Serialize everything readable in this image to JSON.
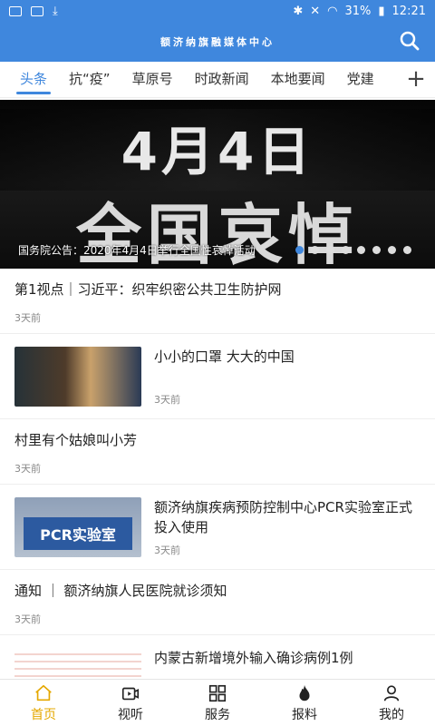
{
  "status_bar": {
    "battery": "31%",
    "time": "12:21"
  },
  "header": {
    "title": "额济纳旗融媒体中心"
  },
  "tabs": [
    {
      "label": "头条",
      "active": true
    },
    {
      "label": "抗“疫”"
    },
    {
      "label": "草原号"
    },
    {
      "label": "时政新闻"
    },
    {
      "label": "本地要闻"
    },
    {
      "label": "党建"
    }
  ],
  "banner": {
    "line1": "4月4日",
    "line2": "全国哀悼",
    "caption": "国务院公告：2020年4月4日举行全国性哀悼活动",
    "dot_count": 8,
    "active_dot": 0
  },
  "feed": [
    {
      "title": "第1视点｜习近平：织牢织密公共卫生防护网",
      "time": "3天前"
    },
    {
      "title": "小小的口罩 大大的中国",
      "time": "3天前",
      "thumb": "mask"
    },
    {
      "title": "村里有个姑娘叫小芳",
      "time": "3天前"
    },
    {
      "title": "额济纳旗疾病预防控制中心PCR实验室正式投入使用",
      "time": "3天前",
      "thumb": "pcr",
      "thumb_text": "PCR实验室"
    },
    {
      "title": "通知 ｜ 额济纳旗人民医院就诊须知",
      "time": "3天前"
    },
    {
      "title": "内蒙古新增境外输入确诊病例1例",
      "thumb": "list"
    }
  ],
  "bottom_nav": [
    {
      "label": "首页",
      "icon": "home-icon",
      "active": true
    },
    {
      "label": "视听",
      "icon": "video-icon"
    },
    {
      "label": "服务",
      "icon": "grid-icon"
    },
    {
      "label": "报料",
      "icon": "fire-icon"
    },
    {
      "label": "我的",
      "icon": "user-icon"
    }
  ],
  "colors": {
    "primary": "#3f87dd",
    "nav_active": "#e5a800"
  }
}
